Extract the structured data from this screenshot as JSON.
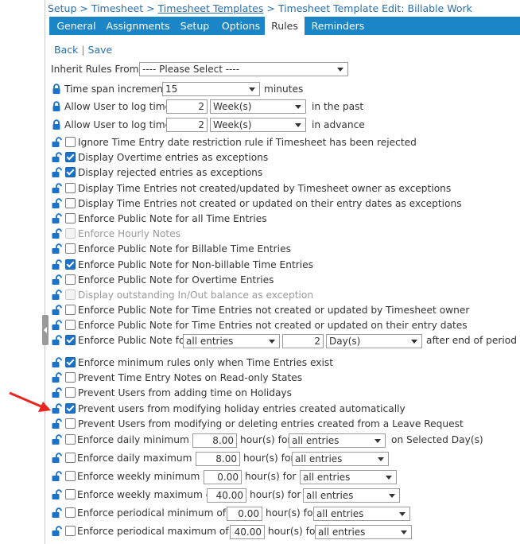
{
  "breadcrumb": {
    "setup": "Setup",
    "sep1": " > ",
    "timesheet": "Timesheet",
    "sep2": " > ",
    "templates": "Timesheet Templates",
    "sep3": " > ",
    "current": "Timesheet Template Edit: Billable Work"
  },
  "tabs": [
    "General",
    "Assignments",
    "Setup",
    "Options",
    "Rules",
    "Reminders"
  ],
  "actions": {
    "back": "Back",
    "sep": "|",
    "save": "Save"
  },
  "inherit": {
    "label": "Inherit Rules From:",
    "value": "---- Please Select ----"
  },
  "timespan": {
    "label": "Time span increment",
    "value": "15",
    "unit": "minutes"
  },
  "past": {
    "label": "Allow User to log time",
    "value": "2",
    "unit": "Week(s)",
    "suffix": "in the past"
  },
  "advance": {
    "label": "Allow User to log time",
    "value": "2",
    "unit": "Week(s)",
    "suffix": "in advance"
  },
  "rules": [
    {
      "label": "Ignore Time Entry date restriction rule if Timesheet has been rejected",
      "checked": false,
      "disabled": false
    },
    {
      "label": "Display Overtime entries as exceptions",
      "checked": true,
      "disabled": false
    },
    {
      "label": "Display rejected entries as exceptions",
      "checked": true,
      "disabled": false
    },
    {
      "label": "Display Time Entries not created/updated by Timesheet owner as exceptions",
      "checked": false,
      "disabled": false
    },
    {
      "label": "Display Time Entries not created or updated on their entry dates as exceptions",
      "checked": false,
      "disabled": false
    },
    {
      "label": "Enforce Public Note for all Time Entries",
      "checked": false,
      "disabled": false
    },
    {
      "label": "Enforce Hourly Notes",
      "checked": false,
      "disabled": true
    },
    {
      "label": "Enforce Public Note for Billable Time Entries",
      "checked": false,
      "disabled": false
    },
    {
      "label": "Enforce Public Note for Non-billable Time Entries",
      "checked": true,
      "disabled": false
    },
    {
      "label": "Enforce Public Note for Overtime Entries",
      "checked": false,
      "disabled": false
    },
    {
      "label": "Display outstanding In/Out balance as exception",
      "checked": false,
      "disabled": true
    },
    {
      "label": "Enforce Public Note for Time Entries not created or updated by Timesheet owner",
      "checked": false,
      "disabled": false
    },
    {
      "label": "Enforce Public Note for Time Entries not created or updated on their entry dates",
      "checked": false,
      "disabled": false
    }
  ],
  "publicNotePeriod": {
    "label": "Enforce Public Note for",
    "scope": "all entries",
    "value": "2",
    "unit": "Day(s)",
    "suffix": "after end of period"
  },
  "rules2": [
    {
      "label": "Enforce minimum rules only when Time Entries exist",
      "checked": true
    },
    {
      "label": "Prevent Time Entry Notes on Read-only States",
      "checked": false
    },
    {
      "label": "Prevent Users from adding time on Holidays",
      "checked": false
    },
    {
      "label": "Prevent users from modifying holiday entries created automatically",
      "checked": true
    },
    {
      "label": "Prevent Users from modifying or deleting entries created from a Leave Request",
      "checked": false
    }
  ],
  "minmax": [
    {
      "label": "Enforce daily minimum of",
      "value": "8.00",
      "unit": "hour(s) for",
      "scope": "all entries",
      "suffix": "on Selected Day(s)"
    },
    {
      "label": "Enforce daily maximum of",
      "value": "8.00",
      "unit": "hour(s) for",
      "scope": "all entries",
      "suffix": ""
    },
    {
      "label": "Enforce weekly minimum of",
      "value": "0.00",
      "unit": "hour(s) for",
      "scope": "all entries",
      "suffix": ""
    },
    {
      "label": "Enforce weekly maximum of",
      "value": "40.00",
      "unit": "hour(s) for",
      "scope": "all entries",
      "suffix": ""
    },
    {
      "label": "Enforce periodical minimum of",
      "value": "0.00",
      "unit": "hour(s) for",
      "scope": "all entries",
      "suffix": ""
    },
    {
      "label": "Enforce periodical maximum of",
      "value": "40.00",
      "unit": "hour(s) for",
      "scope": "all entries",
      "suffix": ""
    }
  ],
  "colors": {
    "accent": "#1a86c8",
    "link": "#2b6ea8",
    "annotation": "#e8261f",
    "checkbox": "#1a73c8"
  },
  "icons": {
    "lock": "lock-icon",
    "unlock": "unlock-icon",
    "arrow": "annotation-arrow-icon"
  }
}
